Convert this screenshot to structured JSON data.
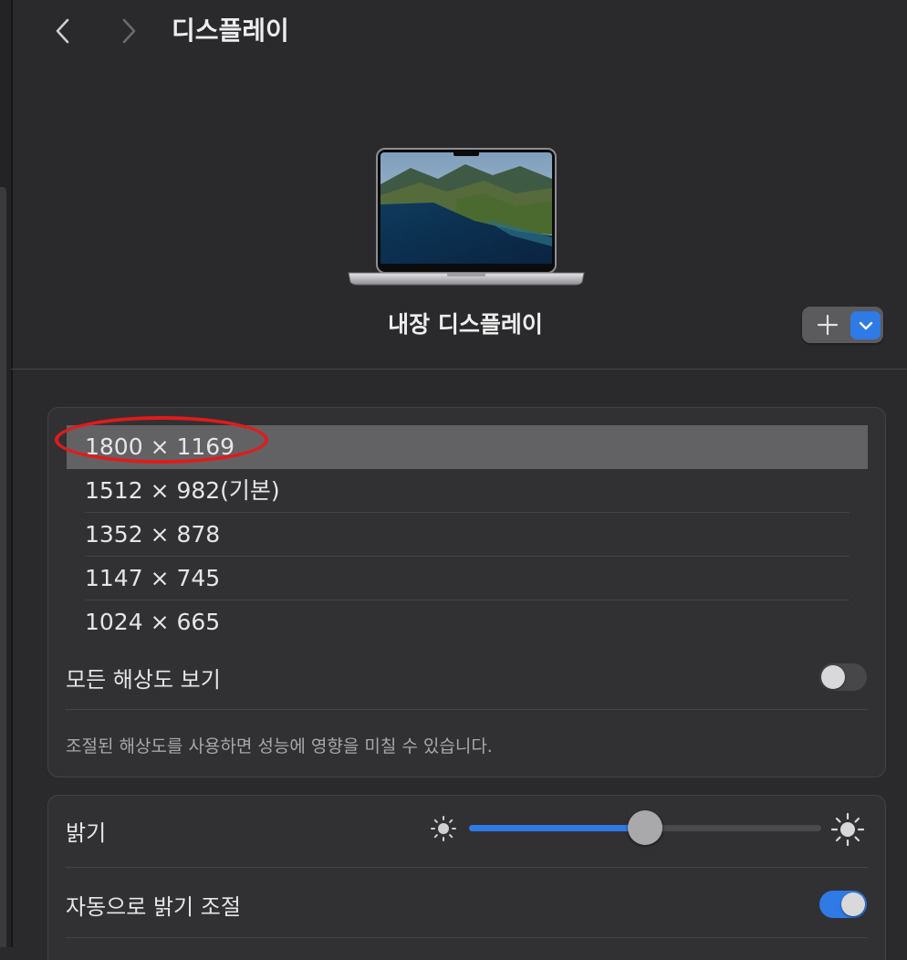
{
  "header": {
    "title": "디스플레이",
    "back_icon": "chevron-left-icon",
    "forward_icon": "chevron-right-icon"
  },
  "display": {
    "name": "내장 디스플레이",
    "add_icon": "plus-icon",
    "menu_icon": "chevron-down-icon"
  },
  "resolutions": {
    "selected_index": 0,
    "items": [
      {
        "label": "1800 × 1169"
      },
      {
        "label": "1512 × 982(기본)"
      },
      {
        "label": "1352 × 878"
      },
      {
        "label": "1147 × 745"
      },
      {
        "label": "1024 × 665"
      }
    ],
    "show_all_label": "모든 해상도 보기",
    "show_all_on": false,
    "note": "조절된 해상도를 사용하면 성능에 영향을 미칠 수 있습니다."
  },
  "brightness": {
    "label": "밝기",
    "level_fraction": 0.5,
    "low_icon": "sun-small-icon",
    "high_icon": "sun-large-icon",
    "auto_label": "자동으로 밝기 조절",
    "auto_on": true
  },
  "colors": {
    "accent": "#2f7ae5",
    "annotation": "#e01b1b"
  }
}
